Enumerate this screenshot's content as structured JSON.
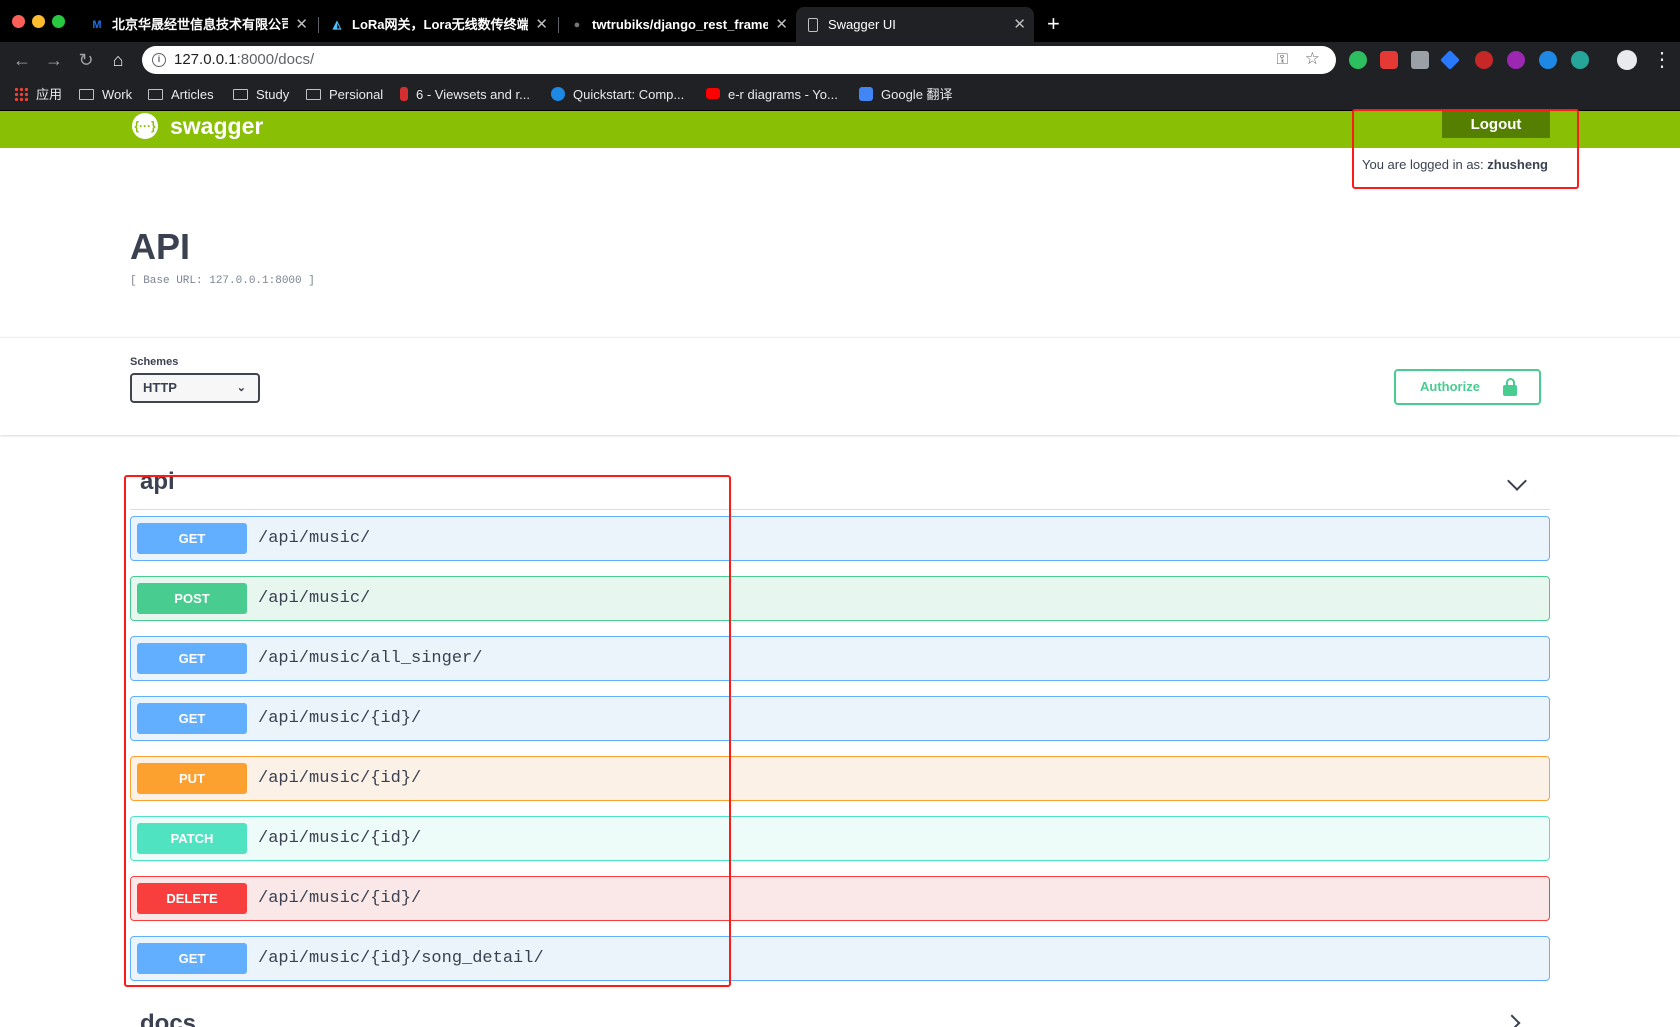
{
  "browser": {
    "tabs": [
      {
        "title": "北京华晟经世信息技术有限公司",
        "favicon": "m-logo-icon",
        "color": "#1a73e8",
        "glyph": "M"
      },
      {
        "title": "LoRa网关，Lora无线数传终端，",
        "favicon": "lora-icon",
        "color": "#4fc3f7",
        "glyph": "◭"
      },
      {
        "title": "twtrubiks/django_rest_framework",
        "favicon": "github-icon",
        "color": "#000000",
        "glyph": "●"
      },
      {
        "title": "Swagger UI",
        "favicon": "page-icon",
        "color": "#202124",
        "glyph": "▯"
      }
    ],
    "url_host": "127.0.0.1",
    "url_path": ":8000/docs/",
    "bookmarks": [
      {
        "label": "应用",
        "icon": "apps-icon"
      },
      {
        "label": "Work",
        "icon": "folder-icon"
      },
      {
        "label": "Articles",
        "icon": "folder-icon"
      },
      {
        "label": "Study",
        "icon": "folder-icon"
      },
      {
        "label": "Persional",
        "icon": "folder-icon"
      },
      {
        "label": "6 - Viewsets and r...",
        "icon": "bookmark-icon",
        "color": "#d32f2f"
      },
      {
        "label": "Quickstart: Comp...",
        "icon": "bookmark-icon",
        "color": "#1e88e5"
      },
      {
        "label": "e-r diagrams - Yo...",
        "icon": "youtube-icon",
        "color": "#ff0000"
      },
      {
        "label": "Google 翻译",
        "icon": "translate-icon",
        "color": "#4285f4"
      }
    ]
  },
  "swagger": {
    "brand": "swagger",
    "logout_label": "Logout",
    "logged_in_prefix": "You are logged in as:",
    "logged_in_user": "zhusheng",
    "title": "API",
    "base_url": "[ Base URL: 127.0.0.1:8000 ]",
    "schemes_label": "Schemes",
    "scheme_selected": "HTTP",
    "authorize_label": "Authorize",
    "tags": [
      {
        "name": "api",
        "operations": [
          {
            "method": "GET",
            "path": "/api/music/"
          },
          {
            "method": "POST",
            "path": "/api/music/"
          },
          {
            "method": "GET",
            "path": "/api/music/all_singer/"
          },
          {
            "method": "GET",
            "path": "/api/music/{id}/"
          },
          {
            "method": "PUT",
            "path": "/api/music/{id}/"
          },
          {
            "method": "PATCH",
            "path": "/api/music/{id}/"
          },
          {
            "method": "DELETE",
            "path": "/api/music/{id}/"
          },
          {
            "method": "GET",
            "path": "/api/music/{id}/song_detail/"
          }
        ]
      },
      {
        "name": "docs"
      }
    ],
    "method_colors": {
      "GET": {
        "badge": "#61affe",
        "bg": "#ebf3fb",
        "border": "#61affe"
      },
      "POST": {
        "badge": "#49cc90",
        "bg": "#e8f6f0",
        "border": "#49cc90"
      },
      "PUT": {
        "badge": "#fca130",
        "bg": "#fbf1e6",
        "border": "#fca130"
      },
      "PATCH": {
        "badge": "#50e3c2",
        "bg": "#edfcf9",
        "border": "#50e3c2"
      },
      "DELETE": {
        "badge": "#f93e3e",
        "bg": "#fae7e7",
        "border": "#f93e3e"
      }
    },
    "accent": "#89bf04"
  }
}
